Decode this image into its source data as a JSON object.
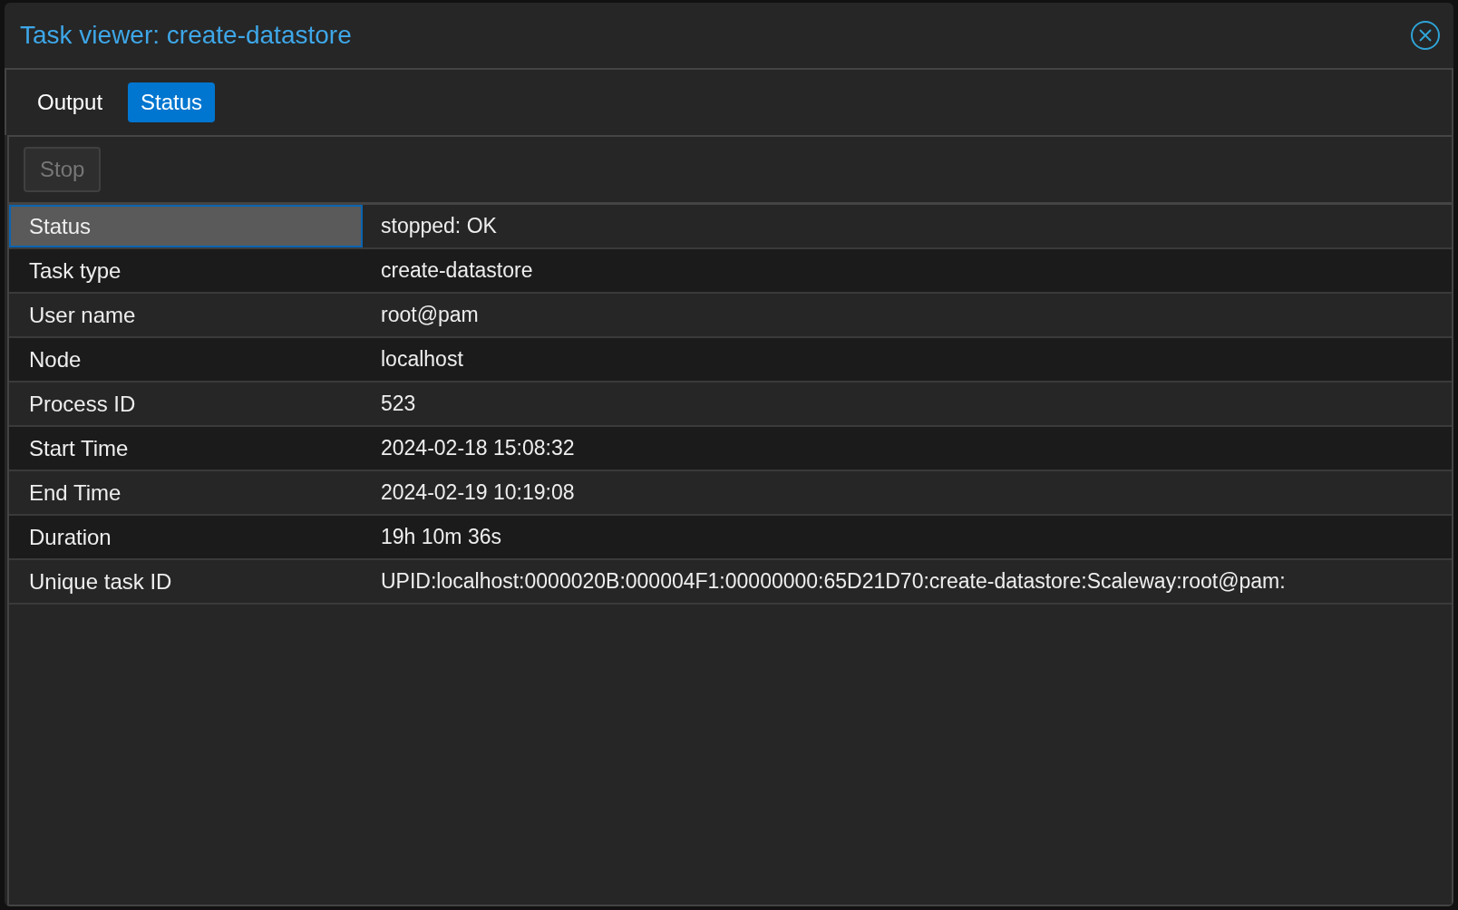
{
  "window": {
    "title": "Task viewer: create-datastore"
  },
  "tabs": [
    {
      "label": "Output",
      "selected": false
    },
    {
      "label": "Status",
      "selected": true
    }
  ],
  "toolbar": {
    "stop_button": {
      "label": "Stop",
      "disabled": true
    }
  },
  "rows": [
    {
      "name": "Status",
      "value": "stopped: OK",
      "selected": true
    },
    {
      "name": "Task type",
      "value": "create-datastore",
      "selected": false
    },
    {
      "name": "User name",
      "value": "root@pam",
      "selected": false
    },
    {
      "name": "Node",
      "value": "localhost",
      "selected": false
    },
    {
      "name": "Process ID",
      "value": "523",
      "selected": false
    },
    {
      "name": "Start Time",
      "value": "2024-02-18 15:08:32",
      "selected": false
    },
    {
      "name": "End Time",
      "value": "2024-02-19 10:19:08",
      "selected": false
    },
    {
      "name": "Duration",
      "value": "19h 10m 36s",
      "selected": false
    },
    {
      "name": "Unique task ID",
      "value": "UPID:localhost:0000020B:000004F1:00000000:65D21D70:create-datastore:Scaleway:root@pam:",
      "selected": false
    }
  ]
}
